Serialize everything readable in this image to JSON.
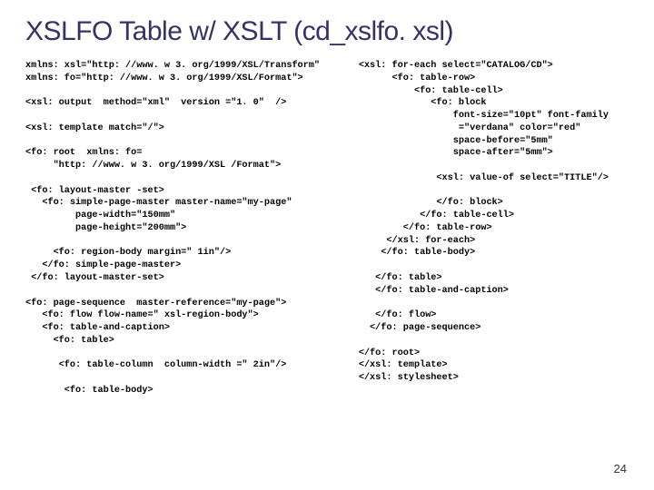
{
  "title": "XSLFO Table w/ XSLT (cd_xslfo. xsl)",
  "code_left": "xmlns: xsl=\"http: //www. w 3. org/1999/XSL/Transform\"\nxmlns: fo=\"http: //www. w 3. org/1999/XSL/Format\">\n\n<xsl: output  method=\"xml\"  version =\"1. 0\"  />\n\n<xsl: template match=\"/\">\n\n<fo: root  xmlns: fo=\n     \"http: //www. w 3. org/1999/XSL /Format\">\n\n <fo: layout-master -set>\n   <fo: simple-page-master master-name=\"my-page\"\n         page-width=\"150mm\"\n         page-height=\"200mm\">\n\n     <fo: region-body margin=\" 1in\"/>\n   </fo: simple-page-master>\n </fo: layout-master-set>\n\n<fo: page-sequence  master-reference=\"my-page\">\n   <fo: flow flow-name=\" xsl-region-body\">\n   <fo: table-and-caption>\n     <fo: table>\n\n      <fo: table-column  column-width =\" 2in\"/>\n\n       <fo: table-body>",
  "code_right": "<xsl: for-each select=\"CATALOG/CD\">\n      <fo: table-row>\n          <fo: table-cell>\n             <fo: block\n                 font-size=\"10pt\" font-family\n                  =\"verdana\" color=\"red\"\n                 space-before=\"5mm\"\n                 space-after=\"5mm\">\n\n              <xsl: value-of select=\"TITLE\"/>\n\n              </fo: block>\n           </fo: table-cell>\n        </fo: table-row>\n     </xsl: for-each>\n    </fo: table-body>\n\n   </fo: table>\n   </fo: table-and-caption>\n\n   </fo: flow>\n  </fo: page-sequence>\n\n</fo: root>\n</xsl: template>\n</xsl: stylesheet>",
  "page_number": "24"
}
